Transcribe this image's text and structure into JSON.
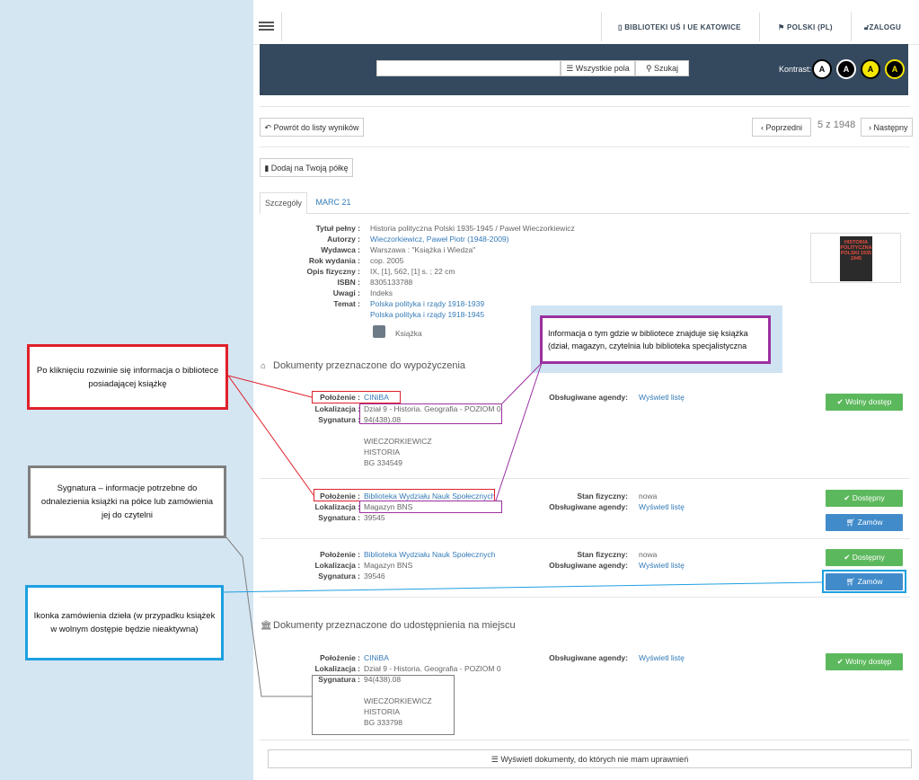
{
  "topbar": {
    "libraries_label": "BIBLIOTEKI UŚ I UE KATOWICE",
    "language_label": "POLSKI (PL)",
    "login_label": "ZALOGU"
  },
  "search": {
    "fields_label": "Wszystkie pola",
    "search_label": "Szukaj",
    "contrast_label": "Kontrast:",
    "contrast_options": [
      "A",
      "A",
      "A",
      "A"
    ]
  },
  "nav": {
    "back_label": "Powrót do listy wyników",
    "prev_label": "Poprzedni",
    "position": "5 z 1948",
    "next_label": "Następny",
    "add_shelf_label": "Dodaj na Twoją półkę"
  },
  "tabs": [
    "Szczegóły",
    "MARC 21"
  ],
  "details": {
    "labels": [
      "Tytuł pełny :",
      "Autorzy :",
      "Wydawca :",
      "Rok wydania :",
      "Opis fizyczny :",
      "ISBN :",
      "Uwagi :",
      "Temat :"
    ],
    "title": "Historia polityczna Polski 1935-1945 / Paweł Wieczorkiewicz",
    "authors": "Wieczorkiewicz, Paweł Piotr (1948-2009)",
    "publisher": "Warszawa : \"Książka i Wiedza\"",
    "year": "cop. 2005",
    "physical": "IX, [1], 562, [1] s. ; 22 cm",
    "isbn": "8305133788",
    "notes": "Indeks",
    "subject1": "Polska polityka i rządy 1918-1939",
    "subject2": "Polska polityka i rządy 1918-1945",
    "format": "Książka",
    "cover_text": "HISTORIA POLITYCZNA POLSKI 1935 1945"
  },
  "loan_section": {
    "title": "Dokumenty przeznaczone do wypożyczenia",
    "items": [
      {
        "location_label": "Położenie :",
        "location": "CINiBA",
        "place_label": "Lokalizacja :",
        "place": "Dział 9 - Historia. Geografia - POZIOM 0",
        "signature_label": "Sygnatura :",
        "signature": "94(438).08",
        "extra1": "WIECZORKIEWICZ",
        "extra2": "HISTORIA",
        "extra3": "BG 334549",
        "agenda_label": "Obsługiwane agendy:",
        "agenda_link": "Wyświetl listę",
        "status": "Wolny dostęp"
      },
      {
        "location_label": "Położenie :",
        "location": "Biblioteka Wydziału Nauk Społecznych",
        "place_label": "Lokalizacja :",
        "place": "Magazyn BNS",
        "signature_label": "Sygnatura :",
        "signature": "39545",
        "condition_label": "Stan fizyczny:",
        "condition": "nowa",
        "agenda_label": "Obsługiwane agendy:",
        "agenda_link": "Wyświetl listę",
        "status": "Dostępny",
        "order": "Zamów"
      },
      {
        "location_label": "Położenie :",
        "location": "Biblioteka Wydziału Nauk Społecznych",
        "place_label": "Lokalizacja :",
        "place": "Magazyn BNS",
        "signature_label": "Sygnatura :",
        "signature": "39546",
        "condition_label": "Stan fizyczny:",
        "condition": "nowa",
        "agenda_label": "Obsługiwane agendy:",
        "agenda_link": "Wyświetl listę",
        "status": "Dostępny",
        "order": "Zamów"
      }
    ]
  },
  "onsite_section": {
    "title": "Dokumenty przeznaczone do udostępnienia na miejscu",
    "item": {
      "location_label": "Położenie :",
      "location": "CINiBA",
      "place_label": "Lokalizacja :",
      "place": "Dział 9 - Historia. Geografia - POZIOM 0",
      "signature_label": "Sygnatura :",
      "signature": "94(438).08",
      "extra1": "WIECZORKIEWICZ",
      "extra2": "HISTORIA",
      "extra3": "BG 333798",
      "agenda_label": "Obsługiwane agendy:",
      "agenda_link": "Wyświetl listę",
      "status": "Wolny dostęp"
    }
  },
  "show_docs_label": "Wyświetl dokumenty, do których nie mam uprawnień",
  "annotations": {
    "library_info": "Po kliknięciu rozwinie się informacja o bibliotece posiadającej książkę",
    "signature_info": "Sygnatura – informacje potrzebne do odnalezienia książki na półce lub zamówienia jej do czytelni",
    "order_info": "Ikonka zamówienia dzieła (w przypadku książek w wolnym dostępie będzie nieaktywna)",
    "location_info": "Informacja o tym gdzie w bibliotece znajduje się książka (dział, magazyn, czytelnia lub biblioteka specjalistyczna"
  },
  "colors": {
    "annot_red": "#e0202a",
    "annot_gray": "#7f7f7f",
    "annot_blue": "#1ea0e0",
    "annot_purple": "#9b30a0",
    "header_dark": "#34495e",
    "green": "#5cb85c",
    "blue": "#428bca"
  }
}
